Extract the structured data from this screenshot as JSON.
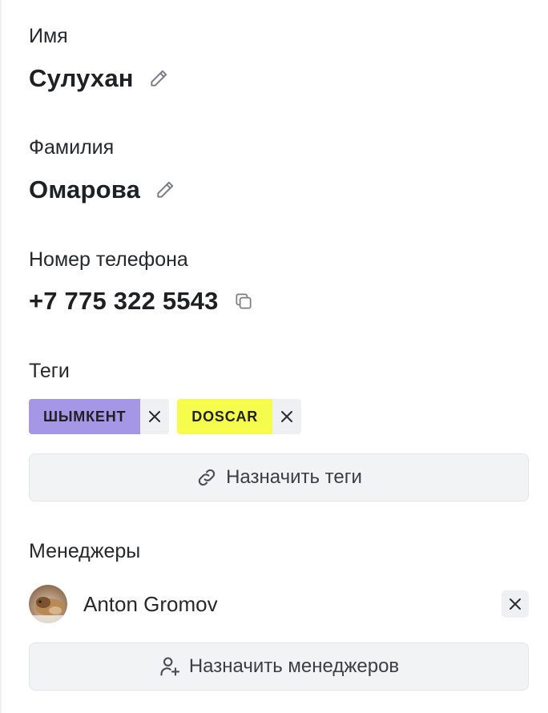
{
  "first_name": {
    "label": "Имя",
    "value": "Сулухан",
    "action_icon": "pencil-icon"
  },
  "last_name": {
    "label": "Фамилия",
    "value": "Омарова",
    "action_icon": "pencil-icon"
  },
  "phone": {
    "label": "Номер телефона",
    "value": "+7 775 322 5543",
    "action_icon": "copy-icon"
  },
  "tags": {
    "label": "Теги",
    "items": [
      {
        "label": "ШЫМКЕНТ",
        "color": "#a596e6"
      },
      {
        "label": "DOSCAR",
        "color": "#f5fc4b"
      }
    ],
    "assign_label": "Назначить теги",
    "assign_icon": "link-icon"
  },
  "managers": {
    "label": "Менеджеры",
    "items": [
      {
        "name": "Anton Gromov",
        "avatar_icon": "dog-photo-avatar"
      }
    ],
    "assign_label": "Назначить менеджеров",
    "assign_icon": "add-user-icon"
  }
}
